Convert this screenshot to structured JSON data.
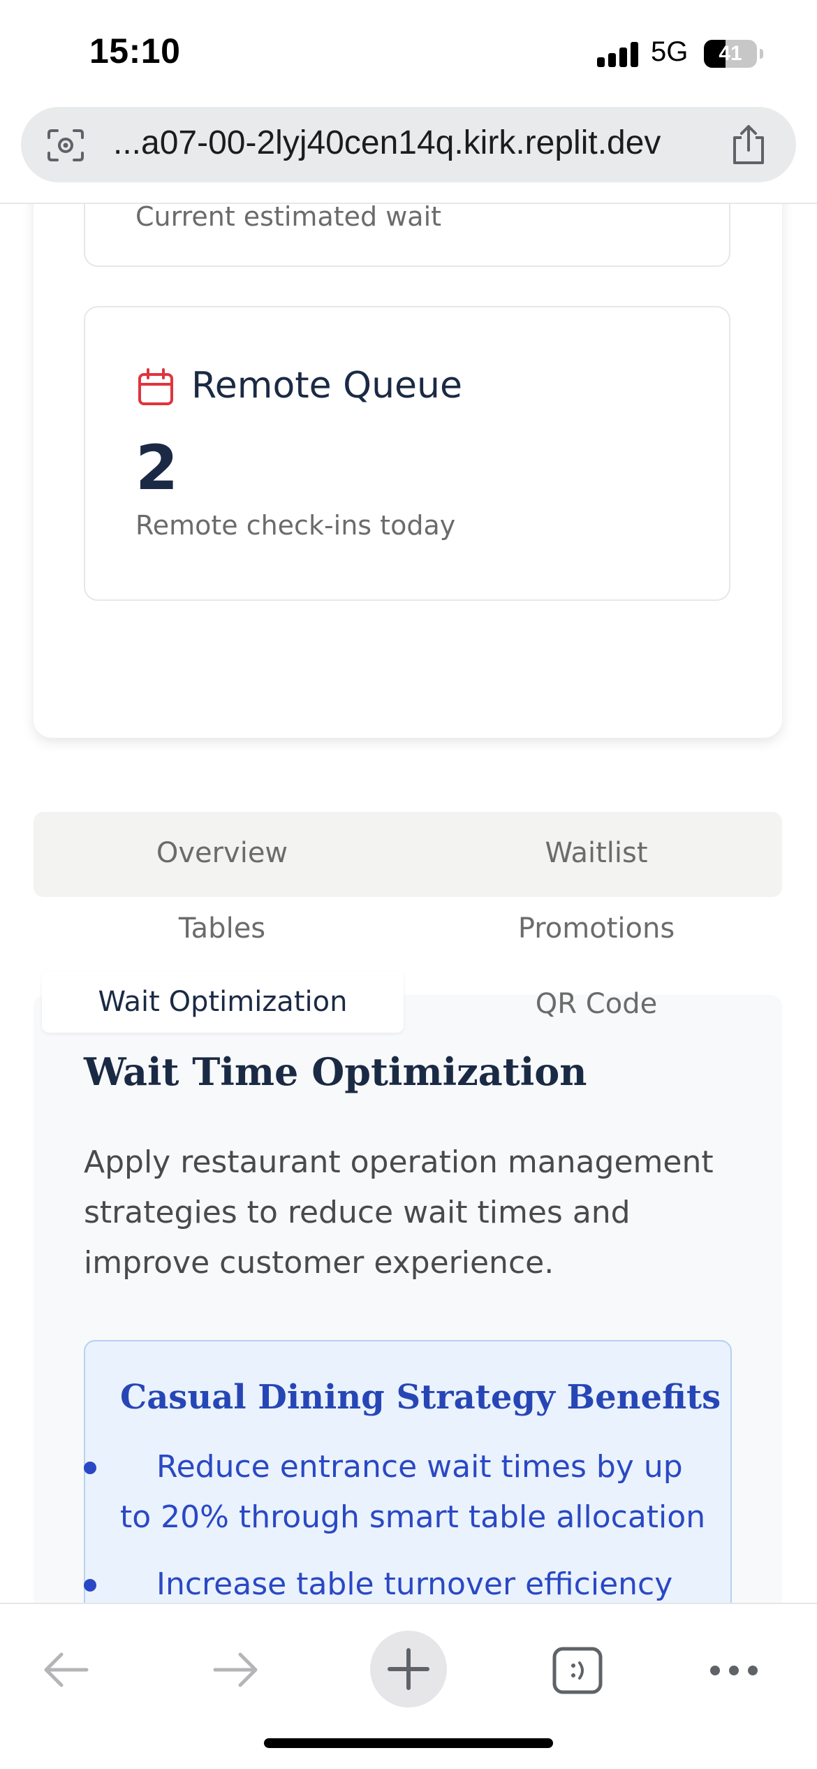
{
  "status_bar": {
    "time": "15:10",
    "network": "5G",
    "battery": "41",
    "battery_level": 0.41
  },
  "browser": {
    "url": "...a07-00-2lyj40cen14q.kirk.replit.dev"
  },
  "stats": {
    "wait_caption": "Current estimated wait",
    "remote_title": "Remote Queue",
    "remote_value": "2",
    "remote_caption": "Remote check-ins today"
  },
  "tabs": {
    "overview": "Overview",
    "waitlist": "Waitlist",
    "tables": "Tables",
    "promotions": "Promotions",
    "wait_optimization": "Wait Optimization",
    "qr_code": "QR Code",
    "active": "wait_optimization"
  },
  "wait_optimization": {
    "title": "Wait Time Optimization",
    "description": "Apply restaurant operation management strategies to reduce wait times and improve customer experience.",
    "benefits_title": "Casual Dining Strategy Benefits",
    "benefits": [
      "Reduce entrance wait times by up to 20% through smart table allocation",
      "Increase table turnover efficiency"
    ]
  },
  "colors": {
    "navy": "#1b2a44",
    "accent_red": "#e0343d",
    "benefit_blue": "#2a48c4",
    "benefit_bg": "#eaf2fd"
  },
  "icons": {
    "status": [
      "signal-icon",
      "battery-icon"
    ],
    "browser": [
      "camera-search-icon",
      "share-icon"
    ],
    "cards": [
      "calendar-icon"
    ],
    "toolbar": [
      "back-arrow-icon",
      "forward-arrow-icon",
      "plus-icon",
      "tabs-icon",
      "more-icon"
    ]
  }
}
